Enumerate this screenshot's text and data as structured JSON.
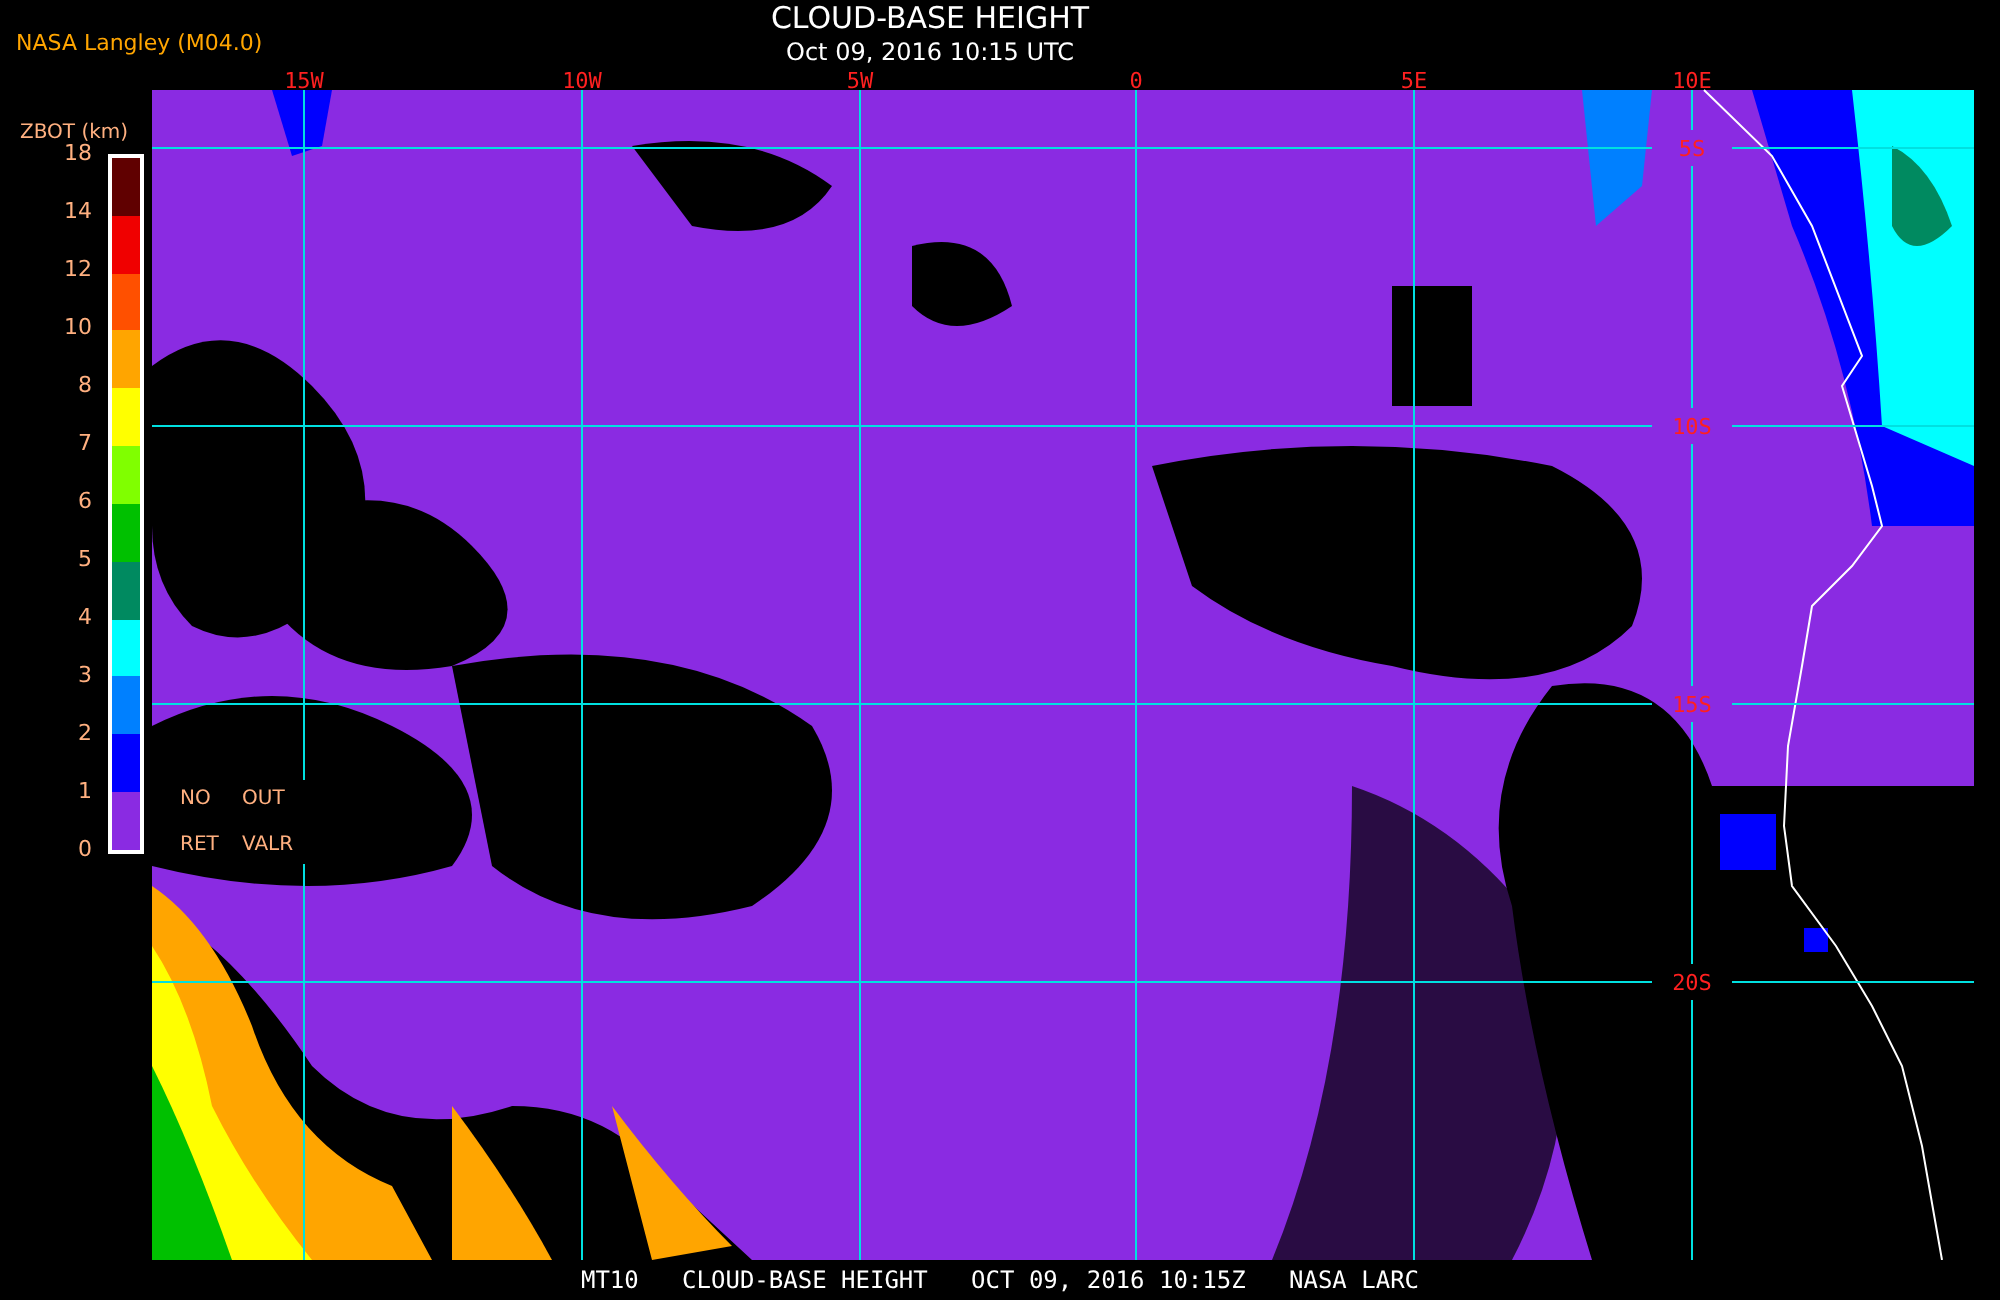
{
  "header": {
    "source": "NASA Langley (M04.0)",
    "title": "CLOUD-BASE HEIGHT",
    "timestamp": "Oct 09, 2016 10:15 UTC"
  },
  "legend": {
    "title": "ZBOT (km)",
    "ticks": [
      "18",
      "14",
      "12",
      "10",
      "8",
      "7",
      "6",
      "5",
      "4",
      "3",
      "2",
      "1",
      "0"
    ],
    "bins": [
      {
        "color": "#600000"
      },
      {
        "color": "#f00000"
      },
      {
        "color": "#ff5000"
      },
      {
        "color": "#ffa500"
      },
      {
        "color": "#ffff00"
      },
      {
        "color": "#80ff00"
      },
      {
        "color": "#00c000"
      },
      {
        "color": "#008a60"
      },
      {
        "color": "#00ffff"
      },
      {
        "color": "#0080ff"
      },
      {
        "color": "#0000ff"
      },
      {
        "color": "#8a2be2"
      }
    ],
    "flags": [
      "NO",
      "OUT",
      "RET",
      "VALR"
    ]
  },
  "map": {
    "longitude_labels": [
      "15W",
      "10W",
      "5W",
      "0",
      "5E",
      "10E"
    ],
    "latitude_labels": [
      "5S",
      "10S",
      "15S",
      "20S"
    ]
  },
  "footer": "MT10   CLOUD-BASE HEIGHT   OCT 09, 2016 10:15Z   NASA LARC"
}
